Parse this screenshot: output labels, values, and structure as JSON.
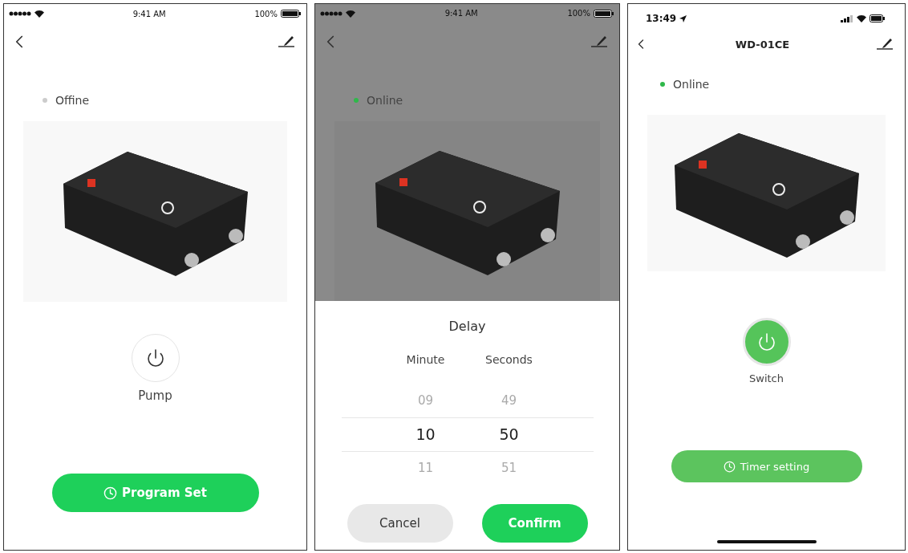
{
  "screens": [
    {
      "status_bar": {
        "kind": "classic",
        "time": "9:41 AM",
        "battery": "100%"
      },
      "dimmed": false,
      "status": {
        "label": "Offine",
        "online": false
      },
      "power": {
        "label": "Pump",
        "on": false
      },
      "action": {
        "label": "Program Set"
      }
    },
    {
      "status_bar": {
        "kind": "classic",
        "time": "9:41 AM",
        "battery": "100%"
      },
      "dimmed": true,
      "status": {
        "label": "Online",
        "online": true
      },
      "sheet": {
        "title": "Delay",
        "columns": [
          {
            "header": "Minute",
            "values": [
              {
                "text": "09",
                "selected": false
              },
              {
                "text": "10",
                "selected": true
              },
              {
                "text": "11",
                "selected": false
              }
            ]
          },
          {
            "header": "Seconds",
            "values": [
              {
                "text": "49",
                "selected": false
              },
              {
                "text": "50",
                "selected": true
              },
              {
                "text": "51",
                "selected": false
              }
            ]
          }
        ],
        "buttons": [
          {
            "label": "Cancel",
            "kind": "secondary"
          },
          {
            "label": "Confirm",
            "kind": "primary"
          }
        ]
      }
    },
    {
      "status_bar": {
        "kind": "modern",
        "time": "13:49"
      },
      "nav": {
        "title": "WD-01CE"
      },
      "dimmed": false,
      "status": {
        "label": "Online",
        "online": true
      },
      "power": {
        "label": "Switch",
        "on": true
      },
      "action": {
        "label": "Timer setting"
      }
    }
  ]
}
